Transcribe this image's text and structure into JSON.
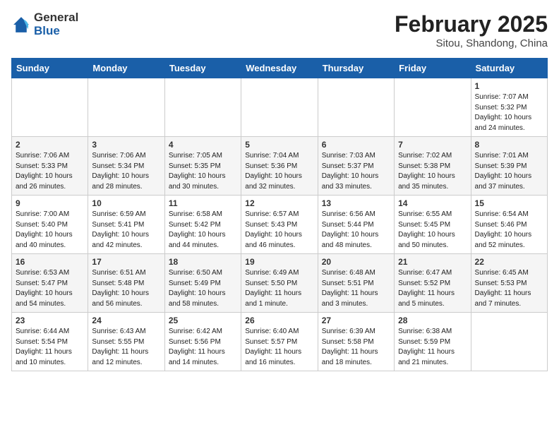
{
  "header": {
    "logo_general": "General",
    "logo_blue": "Blue",
    "month_year": "February 2025",
    "location": "Sitou, Shandong, China"
  },
  "weekdays": [
    "Sunday",
    "Monday",
    "Tuesday",
    "Wednesday",
    "Thursday",
    "Friday",
    "Saturday"
  ],
  "weeks": [
    [
      {
        "day": "",
        "info": ""
      },
      {
        "day": "",
        "info": ""
      },
      {
        "day": "",
        "info": ""
      },
      {
        "day": "",
        "info": ""
      },
      {
        "day": "",
        "info": ""
      },
      {
        "day": "",
        "info": ""
      },
      {
        "day": "1",
        "info": "Sunrise: 7:07 AM\nSunset: 5:32 PM\nDaylight: 10 hours\nand 24 minutes."
      }
    ],
    [
      {
        "day": "2",
        "info": "Sunrise: 7:06 AM\nSunset: 5:33 PM\nDaylight: 10 hours\nand 26 minutes."
      },
      {
        "day": "3",
        "info": "Sunrise: 7:06 AM\nSunset: 5:34 PM\nDaylight: 10 hours\nand 28 minutes."
      },
      {
        "day": "4",
        "info": "Sunrise: 7:05 AM\nSunset: 5:35 PM\nDaylight: 10 hours\nand 30 minutes."
      },
      {
        "day": "5",
        "info": "Sunrise: 7:04 AM\nSunset: 5:36 PM\nDaylight: 10 hours\nand 32 minutes."
      },
      {
        "day": "6",
        "info": "Sunrise: 7:03 AM\nSunset: 5:37 PM\nDaylight: 10 hours\nand 33 minutes."
      },
      {
        "day": "7",
        "info": "Sunrise: 7:02 AM\nSunset: 5:38 PM\nDaylight: 10 hours\nand 35 minutes."
      },
      {
        "day": "8",
        "info": "Sunrise: 7:01 AM\nSunset: 5:39 PM\nDaylight: 10 hours\nand 37 minutes."
      }
    ],
    [
      {
        "day": "9",
        "info": "Sunrise: 7:00 AM\nSunset: 5:40 PM\nDaylight: 10 hours\nand 40 minutes."
      },
      {
        "day": "10",
        "info": "Sunrise: 6:59 AM\nSunset: 5:41 PM\nDaylight: 10 hours\nand 42 minutes."
      },
      {
        "day": "11",
        "info": "Sunrise: 6:58 AM\nSunset: 5:42 PM\nDaylight: 10 hours\nand 44 minutes."
      },
      {
        "day": "12",
        "info": "Sunrise: 6:57 AM\nSunset: 5:43 PM\nDaylight: 10 hours\nand 46 minutes."
      },
      {
        "day": "13",
        "info": "Sunrise: 6:56 AM\nSunset: 5:44 PM\nDaylight: 10 hours\nand 48 minutes."
      },
      {
        "day": "14",
        "info": "Sunrise: 6:55 AM\nSunset: 5:45 PM\nDaylight: 10 hours\nand 50 minutes."
      },
      {
        "day": "15",
        "info": "Sunrise: 6:54 AM\nSunset: 5:46 PM\nDaylight: 10 hours\nand 52 minutes."
      }
    ],
    [
      {
        "day": "16",
        "info": "Sunrise: 6:53 AM\nSunset: 5:47 PM\nDaylight: 10 hours\nand 54 minutes."
      },
      {
        "day": "17",
        "info": "Sunrise: 6:51 AM\nSunset: 5:48 PM\nDaylight: 10 hours\nand 56 minutes."
      },
      {
        "day": "18",
        "info": "Sunrise: 6:50 AM\nSunset: 5:49 PM\nDaylight: 10 hours\nand 58 minutes."
      },
      {
        "day": "19",
        "info": "Sunrise: 6:49 AM\nSunset: 5:50 PM\nDaylight: 11 hours\nand 1 minute."
      },
      {
        "day": "20",
        "info": "Sunrise: 6:48 AM\nSunset: 5:51 PM\nDaylight: 11 hours\nand 3 minutes."
      },
      {
        "day": "21",
        "info": "Sunrise: 6:47 AM\nSunset: 5:52 PM\nDaylight: 11 hours\nand 5 minutes."
      },
      {
        "day": "22",
        "info": "Sunrise: 6:45 AM\nSunset: 5:53 PM\nDaylight: 11 hours\nand 7 minutes."
      }
    ],
    [
      {
        "day": "23",
        "info": "Sunrise: 6:44 AM\nSunset: 5:54 PM\nDaylight: 11 hours\nand 10 minutes."
      },
      {
        "day": "24",
        "info": "Sunrise: 6:43 AM\nSunset: 5:55 PM\nDaylight: 11 hours\nand 12 minutes."
      },
      {
        "day": "25",
        "info": "Sunrise: 6:42 AM\nSunset: 5:56 PM\nDaylight: 11 hours\nand 14 minutes."
      },
      {
        "day": "26",
        "info": "Sunrise: 6:40 AM\nSunset: 5:57 PM\nDaylight: 11 hours\nand 16 minutes."
      },
      {
        "day": "27",
        "info": "Sunrise: 6:39 AM\nSunset: 5:58 PM\nDaylight: 11 hours\nand 18 minutes."
      },
      {
        "day": "28",
        "info": "Sunrise: 6:38 AM\nSunset: 5:59 PM\nDaylight: 11 hours\nand 21 minutes."
      },
      {
        "day": "",
        "info": ""
      }
    ]
  ]
}
